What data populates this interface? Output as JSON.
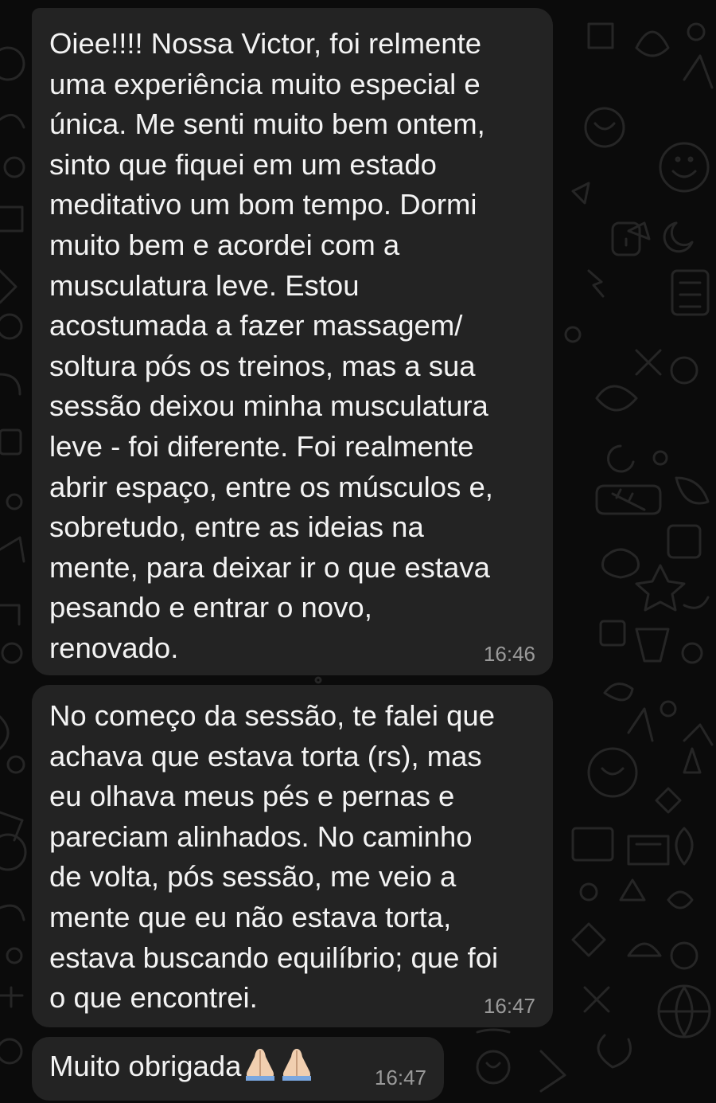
{
  "messages": [
    {
      "text": "Oiee!!!! Nossa Victor, foi relmente\numa experiência muito especial e\núnica. Me senti muito bem ontem,\nsinto que fiquei em um estado\nmeditativo um bom tempo. Dormi\nmuito bem e acordei com a\nmusculatura leve. Estou\nacostumada a fazer massagem/\nsoltura pós os treinos, mas a sua\nsessão deixou minha musculatura\nleve - foi diferente. Foi realmente\nabrir espaço, entre os músculos e,\nsobretudo, entre as ideias na\nmente, para deixar ir o que estava\npesando e entrar o novo,\nrenovado.",
      "time": "16:46"
    },
    {
      "text": "No começo da sessão, te falei que\nachava que estava torta (rs), mas\neu olhava meus pés e pernas e\npareciam alinhados. No caminho\nde volta, pós sessão, me veio a\nmente que eu não estava torta,\nestava buscando equilíbrio; que foi\no que encontrei.",
      "time": "16:47"
    },
    {
      "text": "Muito obrigada",
      "emoji": "folded-hands-icon x2",
      "time": "16:47"
    }
  ],
  "colors": {
    "background": "#0b0b0b",
    "bubble": "#232323",
    "text": "#f3f3f3",
    "timestamp": "#9a9a9a",
    "wallpaper_doodle": "#262626"
  }
}
